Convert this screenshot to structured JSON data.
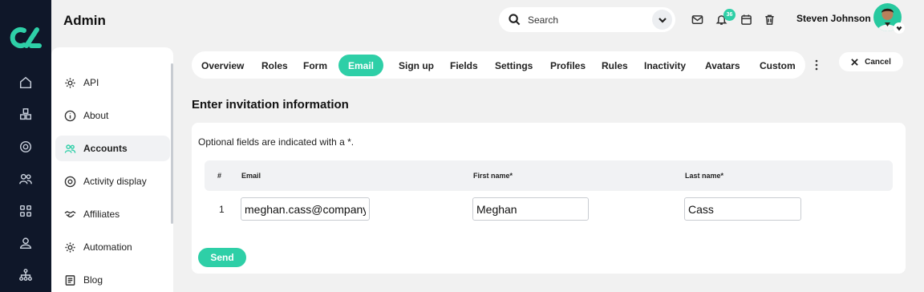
{
  "header": {
    "title": "Admin",
    "search_placeholder": "Search",
    "notification_count": "36",
    "user_name": "Steven Johnson"
  },
  "rail": {
    "icons": [
      "home-icon",
      "cubes-icon",
      "target-icon",
      "users-icon",
      "grid-icon",
      "user-icon",
      "sitemap-icon"
    ]
  },
  "sidebar": {
    "items": [
      {
        "label": "API",
        "icon": "gear-icon"
      },
      {
        "label": "About",
        "icon": "info-icon"
      },
      {
        "label": "Accounts",
        "icon": "users-icon",
        "active": true
      },
      {
        "label": "Activity display",
        "icon": "target-icon"
      },
      {
        "label": "Affiliates",
        "icon": "handshake-icon"
      },
      {
        "label": "Automation",
        "icon": "gear-icon"
      },
      {
        "label": "Blog",
        "icon": "document-icon"
      }
    ]
  },
  "tabs": [
    "Overview",
    "Roles",
    "Form",
    "Email",
    "Sign up",
    "Fields",
    "Settings",
    "Profiles",
    "Rules",
    "Inactivity",
    "Avatars",
    "Custom"
  ],
  "active_tab": "Email",
  "cancel_label": "Cancel",
  "form": {
    "title": "Enter invitation information",
    "hint": "Optional fields are indicated with a *.",
    "columns": {
      "num": "#",
      "email": "Email",
      "first": "First name*",
      "last": "Last name*"
    },
    "row": {
      "num": "1",
      "email": "meghan.cass@company.com",
      "first": "Meghan",
      "last": "Cass"
    },
    "send_label": "Send"
  },
  "colors": {
    "accent": "#2ecfa7",
    "rail": "#0f1729",
    "background": "#f1f1f1"
  }
}
